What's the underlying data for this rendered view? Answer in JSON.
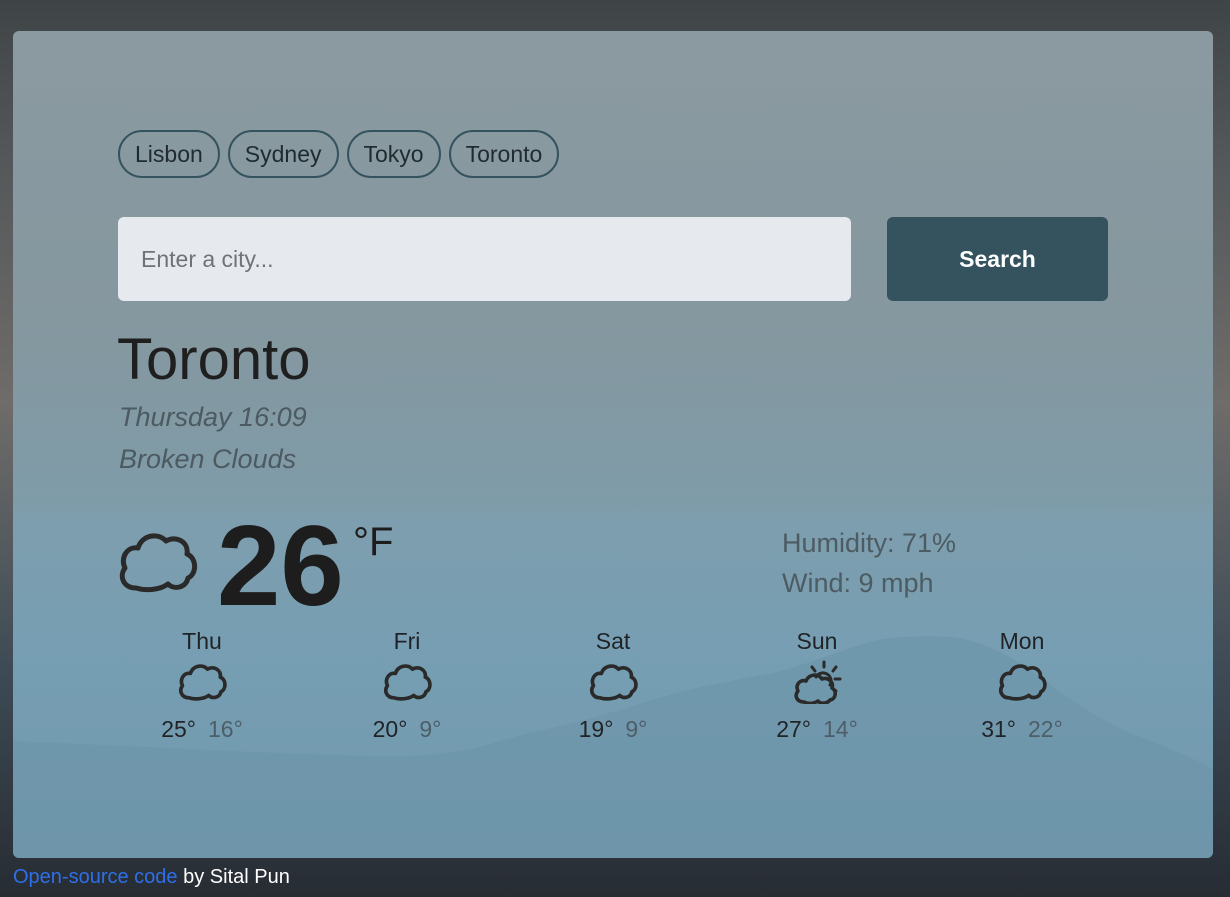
{
  "quick_cities": [
    "Lisbon",
    "Sydney",
    "Tokyo",
    "Toronto"
  ],
  "search": {
    "placeholder": "Enter a city...",
    "button_label": "Search"
  },
  "current": {
    "city": "Toronto",
    "datetime": "Thursday 16:09",
    "description": "Broken Clouds",
    "temperature": "26",
    "unit": "°F",
    "icon": "cloud-icon",
    "humidity": "Humidity: 71%",
    "wind": "Wind: 9 mph"
  },
  "forecast": [
    {
      "day": "Thu",
      "max": "25°",
      "min": "16°",
      "icon": "cloud-icon"
    },
    {
      "day": "Fri",
      "max": "20°",
      "min": "9°",
      "icon": "cloud-icon"
    },
    {
      "day": "Sat",
      "max": "19°",
      "min": "9°",
      "icon": "cloud-icon"
    },
    {
      "day": "Sun",
      "max": "27°",
      "min": "14°",
      "icon": "partly-sunny-icon"
    },
    {
      "day": "Mon",
      "max": "31°",
      "min": "22°",
      "icon": "cloud-icon"
    }
  ],
  "footer": {
    "link_text": "Open-source code",
    "byline": " by Sital Pun"
  },
  "colors": {
    "accent": "#34535f",
    "link": "#2f6fe6",
    "input_background": "#e6e9ed"
  }
}
